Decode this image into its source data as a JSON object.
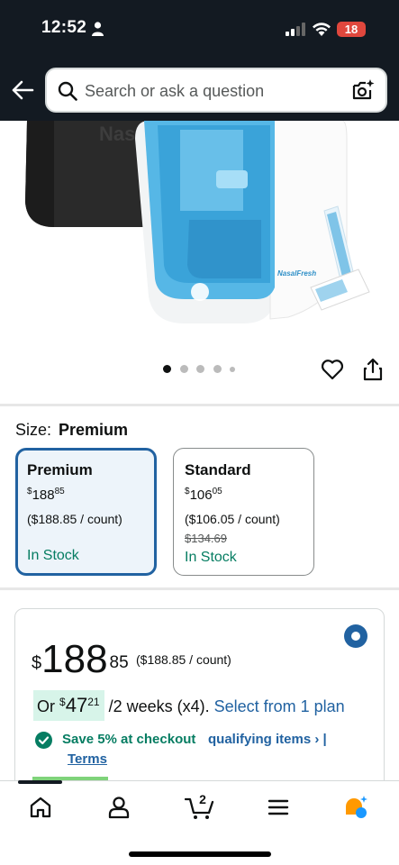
{
  "status_bar": {
    "time": "12:52",
    "battery": "18"
  },
  "search": {
    "placeholder": "Search or ask a question"
  },
  "product_image": {
    "brand_text": "NasalFresh"
  },
  "carousel": {
    "dot_count": 5,
    "active_index": 0
  },
  "size": {
    "label": "Size:",
    "selected": "Premium"
  },
  "options": [
    {
      "name": "Premium",
      "currency": "$",
      "whole": "188",
      "fraction": "85",
      "unit_price": "($188.85 / count)",
      "list_price": "",
      "stock": "In Stock"
    },
    {
      "name": "Standard",
      "currency": "$",
      "whole": "106",
      "fraction": "05",
      "unit_price": "($106.05 / count)",
      "list_price": "$134.69",
      "stock": "In Stock"
    }
  ],
  "buybox": {
    "currency": "$",
    "whole": "188",
    "fraction": "85",
    "unit_price": "($188.85 / count)",
    "subscription": {
      "prefix": "Or",
      "currency": "$",
      "whole": "47",
      "fraction": "21",
      "period": "/2 weeks (x4).",
      "link": "Select from 1 plan"
    },
    "save_text": "Save 5% at checkout",
    "save_link": "qualifying items › |",
    "terms_link": "Terms"
  },
  "bottom_nav": {
    "cart_count": "2"
  },
  "colors": {
    "header_bg": "#131a22",
    "link": "#2162a1",
    "in_stock": "#067d62",
    "selected_bg": "#edf4fa",
    "battery": "#e0473d"
  }
}
